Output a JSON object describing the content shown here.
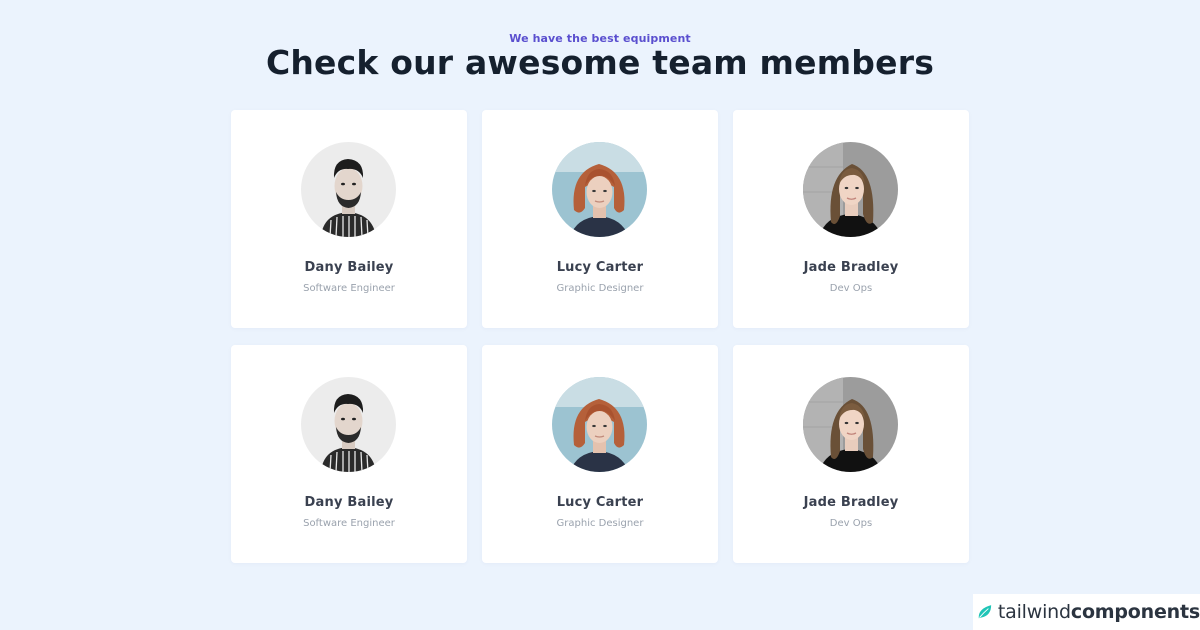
{
  "header": {
    "eyebrow": "We have the best equipment",
    "title": "Check our awesome team members"
  },
  "team": [
    {
      "name": "Dany Bailey",
      "role": "Software Engineer",
      "avatar": "man-bearded"
    },
    {
      "name": "Lucy Carter",
      "role": "Graphic Designer",
      "avatar": "woman-redhead"
    },
    {
      "name": "Jade Bradley",
      "role": "Dev Ops",
      "avatar": "woman-brunette"
    },
    {
      "name": "Dany Bailey",
      "role": "Software Engineer",
      "avatar": "man-bearded"
    },
    {
      "name": "Lucy Carter",
      "role": "Graphic Designer",
      "avatar": "woman-redhead"
    },
    {
      "name": "Jade Bradley",
      "role": "Dev Ops",
      "avatar": "woman-brunette"
    }
  ],
  "brand": {
    "light": "tailwind",
    "bold": "components",
    "icon": "leaf-icon",
    "accent": "#20c5b7"
  },
  "colors": {
    "background": "#ebf3fd",
    "eyebrow": "#5a4fcf",
    "title": "#15202e",
    "card": "#ffffff"
  }
}
